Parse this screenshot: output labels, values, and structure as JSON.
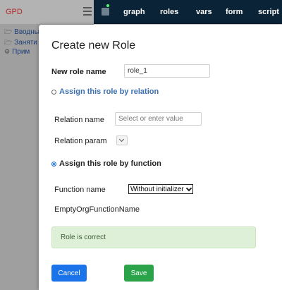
{
  "app": {
    "title": "GPD",
    "tree": [
      {
        "icon": "folder-icon",
        "label": "Вводные"
      },
      {
        "icon": "folder-icon",
        "label": "Заняти"
      },
      {
        "icon": "gear-icon",
        "label": "Прим"
      }
    ],
    "nav": [
      "graph",
      "roles",
      "vars",
      "form",
      "script"
    ]
  },
  "modal": {
    "title": "Create new Role",
    "new_role_name_label": "New role name",
    "new_role_name_value": "role_1",
    "assign_by_relation_label": "Assign this role by relation",
    "relation_name_label": "Relation name",
    "relation_name_placeholder": "Select or enter value",
    "relation_param_label": "Relation param",
    "assign_by_function_label": "Assign this role by function",
    "function_name_label": "Function name",
    "function_name_selected": "Without initializer",
    "function_value_text": "EmptyOrgFunctionName",
    "status_message": "Role is correct",
    "cancel_label": "Cancel",
    "save_label": "Save"
  },
  "colors": {
    "nav_bg": "#0b2336",
    "cancel_button": "#1a73e8",
    "save_button": "#2aa34a",
    "success_alert": "#dff0d8"
  }
}
